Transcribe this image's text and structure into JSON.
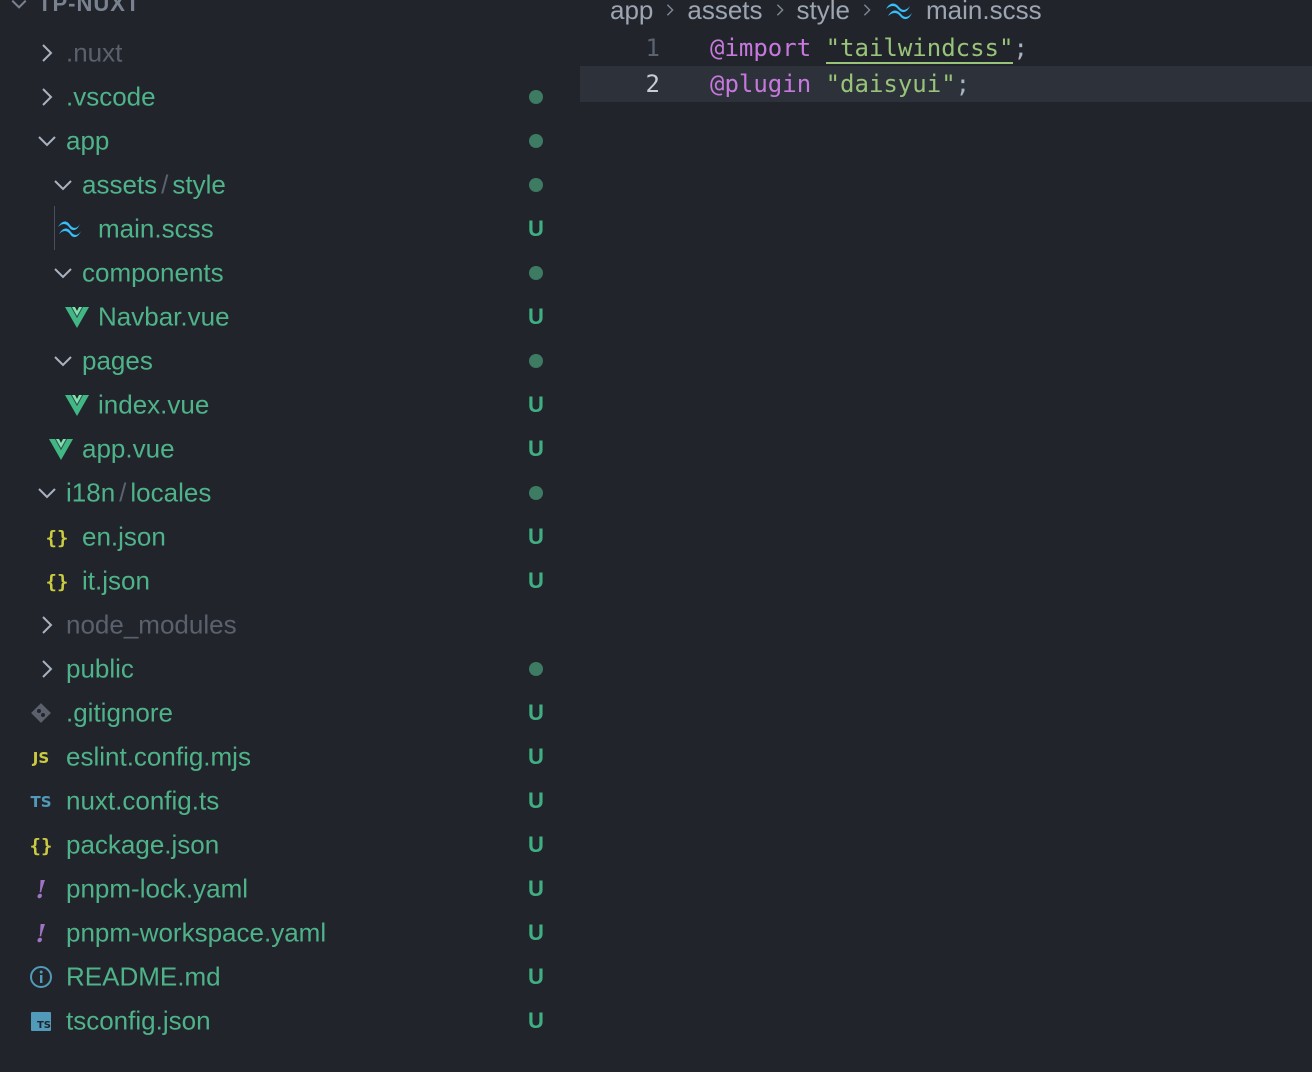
{
  "explorer": {
    "root_label": "TP-NUXT",
    "items": [
      {
        "label": ".nuxt",
        "kind": "folder-closed",
        "status": "",
        "tone": "dim"
      },
      {
        "label": ".vscode",
        "kind": "folder-closed",
        "status": "dot",
        "tone": "git-new"
      },
      {
        "label": "app",
        "kind": "folder-open",
        "status": "dot",
        "tone": "git-new"
      },
      {
        "label": "assets",
        "label2": "style",
        "kind": "folder-open",
        "status": "dot",
        "tone": "git-new"
      },
      {
        "label": "main.scss",
        "kind": "tailwind",
        "status": "U",
        "tone": "git-new"
      },
      {
        "label": "components",
        "kind": "folder-open",
        "status": "dot",
        "tone": "git-new"
      },
      {
        "label": "Navbar.vue",
        "kind": "vue",
        "status": "U",
        "tone": "git-new"
      },
      {
        "label": "pages",
        "kind": "folder-open",
        "status": "dot",
        "tone": "git-new"
      },
      {
        "label": "index.vue",
        "kind": "vue",
        "status": "U",
        "tone": "git-new"
      },
      {
        "label": "app.vue",
        "kind": "vue",
        "status": "U",
        "tone": "git-new"
      },
      {
        "label": "i18n",
        "label2": "locales",
        "kind": "folder-open",
        "status": "dot",
        "tone": "git-new"
      },
      {
        "label": "en.json",
        "kind": "json",
        "status": "U",
        "tone": "git-new"
      },
      {
        "label": "it.json",
        "kind": "json",
        "status": "U",
        "tone": "git-new"
      },
      {
        "label": "node_modules",
        "kind": "folder-closed",
        "status": "",
        "tone": "dim"
      },
      {
        "label": "public",
        "kind": "folder-closed",
        "status": "dot",
        "tone": "git-new"
      },
      {
        "label": ".gitignore",
        "kind": "git",
        "status": "U",
        "tone": "git-new"
      },
      {
        "label": "eslint.config.mjs",
        "kind": "js",
        "status": "U",
        "tone": "git-new"
      },
      {
        "label": "nuxt.config.ts",
        "kind": "ts",
        "status": "U",
        "tone": "git-new"
      },
      {
        "label": "package.json",
        "kind": "json",
        "status": "U",
        "tone": "git-new"
      },
      {
        "label": "pnpm-lock.yaml",
        "kind": "yaml",
        "status": "U",
        "tone": "git-new"
      },
      {
        "label": "pnpm-workspace.yaml",
        "kind": "yaml",
        "status": "U",
        "tone": "git-new"
      },
      {
        "label": "README.md",
        "kind": "info",
        "status": "U",
        "tone": "git-new"
      },
      {
        "label": "tsconfig.json",
        "kind": "tsconfig",
        "status": "U",
        "tone": "git-new"
      }
    ]
  },
  "breadcrumb": {
    "parts": [
      "app",
      "assets",
      "style"
    ],
    "file": "main.scss"
  },
  "editor": {
    "lines": [
      {
        "number": "1",
        "keyword": "@import",
        "string": "\"tailwindcss\"",
        "end": ";"
      },
      {
        "number": "2",
        "keyword": "@plugin",
        "string": "\"daisyui\"",
        "end": ";"
      }
    ]
  },
  "icons": {
    "vue": "vue-icon",
    "tailwind": "tailwind-icon",
    "json": "json-icon",
    "git": "git-icon",
    "js": "javascript-icon",
    "ts": "typescript-icon",
    "yaml": "yaml-icon",
    "info": "info-icon",
    "tsconfig": "tsconfig-icon"
  },
  "colors": {
    "background": "#21252b",
    "git_untracked": "#4fb389",
    "keyword": "#c678dd",
    "string": "#98c379"
  }
}
